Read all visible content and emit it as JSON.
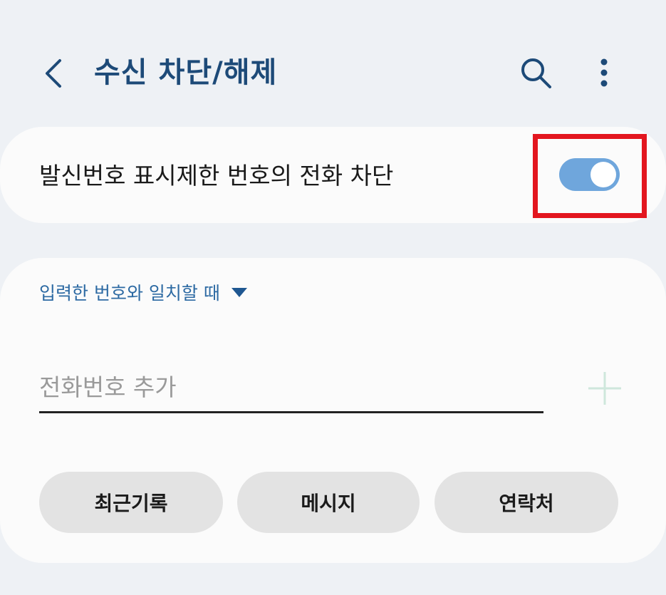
{
  "header": {
    "title": "수신 차단/해제",
    "back_icon": "chevron-left-icon",
    "search_icon": "search-icon",
    "more_icon": "more-vertical-icon",
    "title_color": "#1d4a78"
  },
  "block_hidden_number": {
    "label": "발신번호 표시제한 번호의 전화 차단",
    "toggle_on": true,
    "toggle_color": "#6fa6dc"
  },
  "highlight": {
    "color": "#e3161f"
  },
  "block_list": {
    "condition_label": "입력한 번호와 일치할 때",
    "condition_icon": "caret-down-icon",
    "input_placeholder": "전화번호 추가",
    "input_value": "",
    "add_icon": "plus-icon",
    "buttons": [
      {
        "label": "최근기록"
      },
      {
        "label": "메시지"
      },
      {
        "label": "연락처"
      }
    ]
  }
}
